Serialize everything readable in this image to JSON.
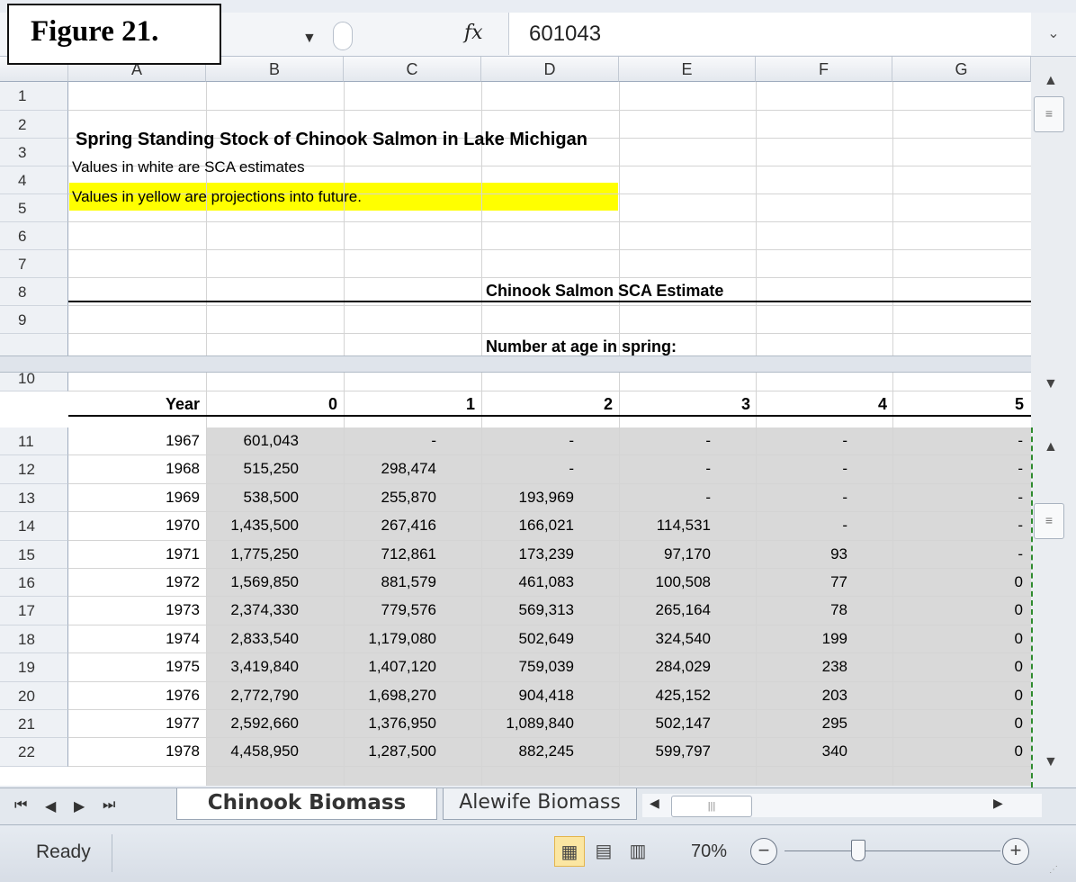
{
  "figure_label": "Figure 21.",
  "formula_bar": {
    "fx_label": "fx",
    "value": "601043"
  },
  "columns": [
    "A",
    "B",
    "C",
    "D",
    "E",
    "F",
    "G"
  ],
  "top_rows": [
    "1",
    "2",
    "3",
    "4",
    "5",
    "6",
    "7",
    "8",
    "9",
    "10"
  ],
  "title": "Spring Standing Stock of Chinook Salmon in Lake Michigan",
  "note_white": "Values in white are SCA estimates",
  "note_yellow": "Values in yellow are projections into future.",
  "header1": "Chinook Salmon SCA Estimate",
  "header2": "Number at age in spring:",
  "col_headers": [
    "Year",
    "0",
    "1",
    "2",
    "3",
    "4",
    "5"
  ],
  "data_rows": [
    {
      "row": "11",
      "cells": [
        "1967",
        "601,043",
        "-",
        "-",
        "-",
        "-",
        "-"
      ]
    },
    {
      "row": "12",
      "cells": [
        "1968",
        "515,250",
        "298,474",
        "-",
        "-",
        "-",
        "-"
      ]
    },
    {
      "row": "13",
      "cells": [
        "1969",
        "538,500",
        "255,870",
        "193,969",
        "-",
        "-",
        "-"
      ]
    },
    {
      "row": "14",
      "cells": [
        "1970",
        "1,435,500",
        "267,416",
        "166,021",
        "114,531",
        "-",
        "-"
      ]
    },
    {
      "row": "15",
      "cells": [
        "1971",
        "1,775,250",
        "712,861",
        "173,239",
        "97,170",
        "93",
        "-"
      ]
    },
    {
      "row": "16",
      "cells": [
        "1972",
        "1,569,850",
        "881,579",
        "461,083",
        "100,508",
        "77",
        "0"
      ]
    },
    {
      "row": "17",
      "cells": [
        "1973",
        "2,374,330",
        "779,576",
        "569,313",
        "265,164",
        "78",
        "0"
      ]
    },
    {
      "row": "18",
      "cells": [
        "1974",
        "2,833,540",
        "1,179,080",
        "502,649",
        "324,540",
        "199",
        "0"
      ]
    },
    {
      "row": "19",
      "cells": [
        "1975",
        "3,419,840",
        "1,407,120",
        "759,039",
        "284,029",
        "238",
        "0"
      ]
    },
    {
      "row": "20",
      "cells": [
        "1976",
        "2,772,790",
        "1,698,270",
        "904,418",
        "425,152",
        "203",
        "0"
      ]
    },
    {
      "row": "21",
      "cells": [
        "1977",
        "2,592,660",
        "1,376,950",
        "1,089,840",
        "502,147",
        "295",
        "0"
      ]
    },
    {
      "row": "22",
      "cells": [
        "1978",
        "4,458,950",
        "1,287,500",
        "882,245",
        "599,797",
        "340",
        "0"
      ]
    }
  ],
  "tabs": {
    "active": "Chinook Biomass",
    "other": "Alewife Biomass"
  },
  "status": {
    "text": "Ready",
    "zoom": "70%"
  }
}
